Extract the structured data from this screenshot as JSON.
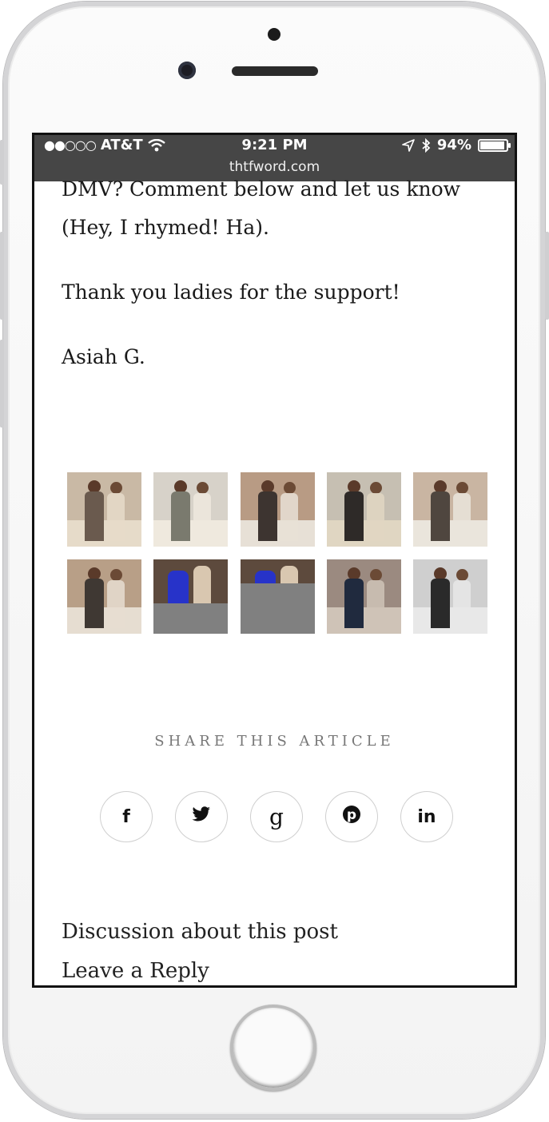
{
  "status_bar": {
    "carrier": "AT&T",
    "time": "9:21 PM",
    "battery": "94%",
    "battery_level": 0.94,
    "url": "thtfword.com"
  },
  "article": {
    "line1": "DMV? Comment below and let us know",
    "line2": "(Hey, I rhymed! Ha).",
    "thanks": "Thank you ladies for the support!",
    "signature": "Asiah G."
  },
  "gallery": {
    "images": [
      {
        "icon": "photo-two-women-street",
        "colors": [
          "#c9b9a5",
          "#6a5a4e",
          "#e6dbc9"
        ]
      },
      {
        "icon": "photo-two-women-sidewalk",
        "colors": [
          "#d7d2c9",
          "#7a7a6e",
          "#efe9de"
        ]
      },
      {
        "icon": "photo-two-women-storefront",
        "colors": [
          "#b89b84",
          "#3d3430",
          "#e7e0d6"
        ]
      },
      {
        "icon": "photo-woman-skirt",
        "colors": [
          "#c6bfb2",
          "#2e2a28",
          "#e0d6c2"
        ]
      },
      {
        "icon": "photo-two-women-boutique",
        "colors": [
          "#c9b5a2",
          "#4f463f",
          "#eae5dc"
        ]
      },
      {
        "icon": "photo-two-women-shop",
        "colors": [
          "#b89f87",
          "#3f3833",
          "#e6ddd1"
        ]
      },
      {
        "icon": "photo-blue-dress-partial",
        "colors": [
          "#5d4a3d",
          "#2733c9",
          "#808080"
        ]
      },
      {
        "icon": "photo-blue-dress-loading",
        "colors": [
          "#5d4a3d",
          "#2733c9",
          "#808080"
        ]
      },
      {
        "icon": "photo-woman-navy-jumpsuit",
        "colors": [
          "#9b8a80",
          "#202a3e",
          "#cfc3b7"
        ]
      },
      {
        "icon": "photo-woman-walking",
        "colors": [
          "#cfcfcf",
          "#2a2a2a",
          "#e8e8e8"
        ]
      }
    ]
  },
  "share": {
    "title": "SHARE THIS ARTICLE",
    "buttons": [
      {
        "glyph": "f",
        "icon": "facebook-icon"
      },
      {
        "glyph": "🐦",
        "icon": "twitter-icon"
      },
      {
        "glyph": "g",
        "icon": "google-plus-icon"
      },
      {
        "glyph": "P",
        "icon": "pinterest-icon"
      },
      {
        "glyph": "in",
        "icon": "linkedin-icon"
      }
    ]
  },
  "discussion": {
    "title": "Discussion about this post",
    "reply": "Leave a Reply"
  }
}
